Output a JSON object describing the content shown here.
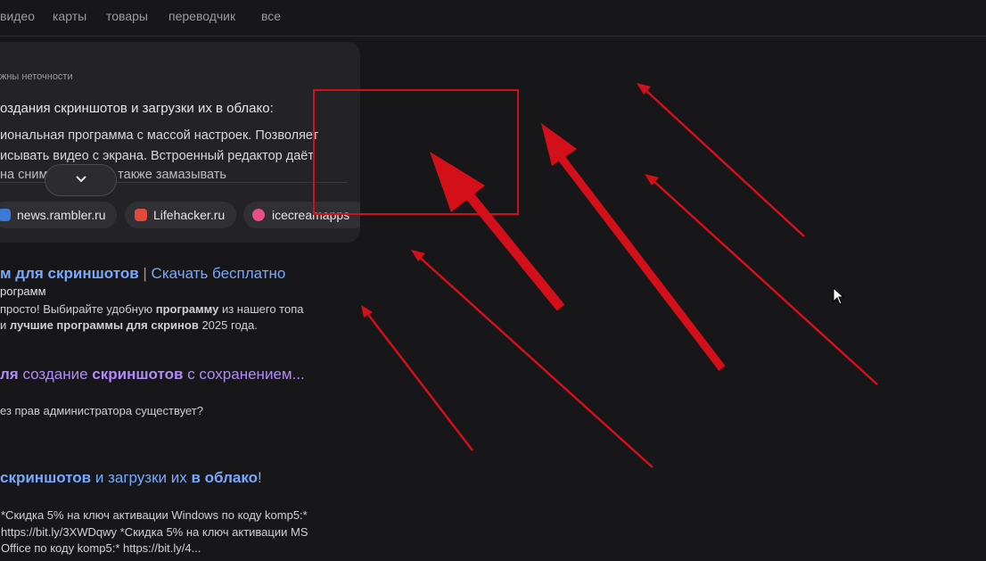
{
  "nav": [
    "видео",
    "карты",
    "товары",
    "переводчик",
    "все"
  ],
  "card": {
    "note": "жны неточности",
    "heading": "оздания скриншотов и загрузки их в облако:",
    "lines": [
      "иональная программа с массой настроек. Позволяет",
      "исывать видео с экрана. Встроенный редактор даёт",
      "на сним          пометки, а также замазывать"
    ],
    "expand_icon": "chevron-down-icon",
    "sources": [
      {
        "label": "news.rambler.ru",
        "icon": "rambler-favicon",
        "color": "#3a7bd5"
      },
      {
        "label": "Lifehacker.ru",
        "icon": "lifehacker-favicon",
        "color": "#e0493b"
      },
      {
        "label": "icecreamapps",
        "icon": "icecream-favicon",
        "color": "#e84e8a"
      }
    ]
  },
  "results": [
    {
      "title_a": "м для скриншотов",
      "title_sep": " | ",
      "title_b": "Скачать бесплатно",
      "site": "рограмм",
      "snippet1_a": "просто! Выбирайте удобную ",
      "snippet1_b": "программу",
      "snippet1_c": " из нашего топа",
      "snippet2_a": "и ",
      "snippet2_b": "лучшие программы для скринов",
      "snippet2_c": " 2025 года."
    },
    {
      "title_a": "ля",
      "title_b": " создание ",
      "title_c": "скриншотов",
      "title_d": " с сохранением...",
      "snippet": "ез прав администратора существует?"
    },
    {
      "title_a": "скриншотов",
      "title_b": " и загрузки их ",
      "title_c": "в облако",
      "title_d": "!",
      "snippet1": "*Скидка 5% на ключ активации Windows по коду komp5:*",
      "snippet2": "https://bit.ly/3XWDqwy *Скидка 5% на ключ активации MS",
      "snippet3": "Office по коду komp5:* https://bit.ly/4..."
    }
  ],
  "annotation_color": "#d3101a",
  "cursor_icon": "mouse-pointer-icon"
}
